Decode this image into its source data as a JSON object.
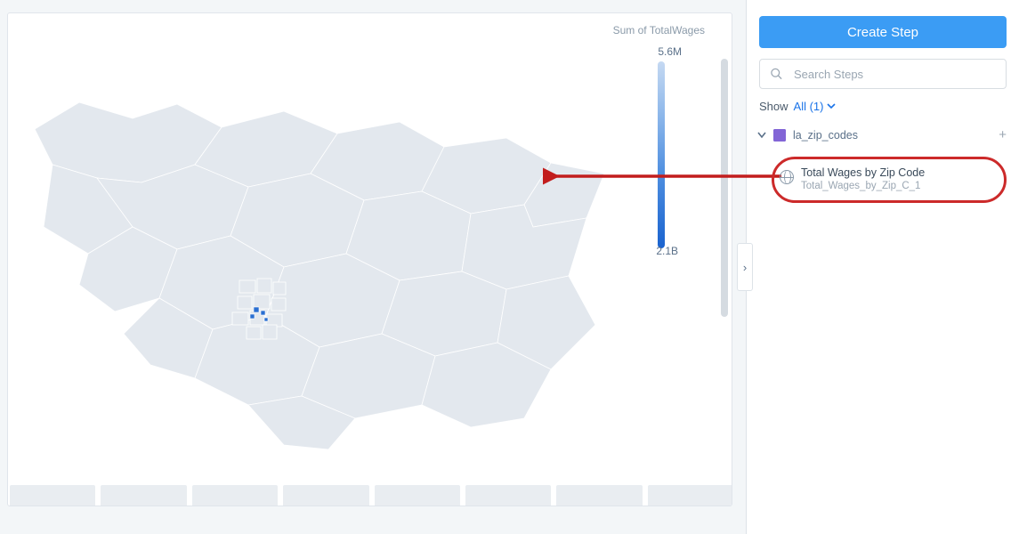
{
  "main": {
    "legend_title": "Sum of TotalWages",
    "legend_max": "5.6M",
    "legend_min": "2.1B",
    "expand_arrow": "›"
  },
  "sidebar": {
    "create_button": "Create Step",
    "search_placeholder": "Search Steps",
    "show_label": "Show",
    "show_filter": "All (1)",
    "dataset": {
      "name": "la_zip_codes"
    },
    "step": {
      "title": "Total Wages by Zip Code",
      "id": "Total_Wages_by_Zip_C_1"
    },
    "plus": "+"
  }
}
